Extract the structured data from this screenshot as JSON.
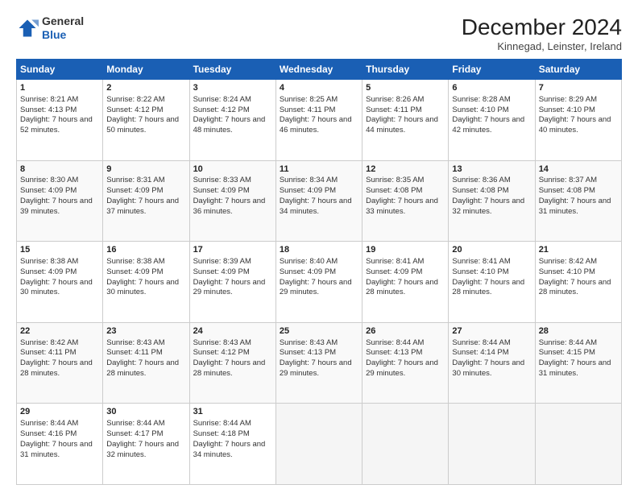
{
  "header": {
    "logo_line1": "General",
    "logo_line2": "Blue",
    "month_title": "December 2024",
    "location": "Kinnegad, Leinster, Ireland"
  },
  "days_of_week": [
    "Sunday",
    "Monday",
    "Tuesday",
    "Wednesday",
    "Thursday",
    "Friday",
    "Saturday"
  ],
  "weeks": [
    [
      {
        "day": 1,
        "sunrise": "8:21 AM",
        "sunset": "4:13 PM",
        "daylight": "7 hours and 52 minutes."
      },
      {
        "day": 2,
        "sunrise": "8:22 AM",
        "sunset": "4:12 PM",
        "daylight": "7 hours and 50 minutes."
      },
      {
        "day": 3,
        "sunrise": "8:24 AM",
        "sunset": "4:12 PM",
        "daylight": "7 hours and 48 minutes."
      },
      {
        "day": 4,
        "sunrise": "8:25 AM",
        "sunset": "4:11 PM",
        "daylight": "7 hours and 46 minutes."
      },
      {
        "day": 5,
        "sunrise": "8:26 AM",
        "sunset": "4:11 PM",
        "daylight": "7 hours and 44 minutes."
      },
      {
        "day": 6,
        "sunrise": "8:28 AM",
        "sunset": "4:10 PM",
        "daylight": "7 hours and 42 minutes."
      },
      {
        "day": 7,
        "sunrise": "8:29 AM",
        "sunset": "4:10 PM",
        "daylight": "7 hours and 40 minutes."
      }
    ],
    [
      {
        "day": 8,
        "sunrise": "8:30 AM",
        "sunset": "4:09 PM",
        "daylight": "7 hours and 39 minutes."
      },
      {
        "day": 9,
        "sunrise": "8:31 AM",
        "sunset": "4:09 PM",
        "daylight": "7 hours and 37 minutes."
      },
      {
        "day": 10,
        "sunrise": "8:33 AM",
        "sunset": "4:09 PM",
        "daylight": "7 hours and 36 minutes."
      },
      {
        "day": 11,
        "sunrise": "8:34 AM",
        "sunset": "4:09 PM",
        "daylight": "7 hours and 34 minutes."
      },
      {
        "day": 12,
        "sunrise": "8:35 AM",
        "sunset": "4:08 PM",
        "daylight": "7 hours and 33 minutes."
      },
      {
        "day": 13,
        "sunrise": "8:36 AM",
        "sunset": "4:08 PM",
        "daylight": "7 hours and 32 minutes."
      },
      {
        "day": 14,
        "sunrise": "8:37 AM",
        "sunset": "4:08 PM",
        "daylight": "7 hours and 31 minutes."
      }
    ],
    [
      {
        "day": 15,
        "sunrise": "8:38 AM",
        "sunset": "4:09 PM",
        "daylight": "7 hours and 30 minutes."
      },
      {
        "day": 16,
        "sunrise": "8:38 AM",
        "sunset": "4:09 PM",
        "daylight": "7 hours and 30 minutes."
      },
      {
        "day": 17,
        "sunrise": "8:39 AM",
        "sunset": "4:09 PM",
        "daylight": "7 hours and 29 minutes."
      },
      {
        "day": 18,
        "sunrise": "8:40 AM",
        "sunset": "4:09 PM",
        "daylight": "7 hours and 29 minutes."
      },
      {
        "day": 19,
        "sunrise": "8:41 AM",
        "sunset": "4:09 PM",
        "daylight": "7 hours and 28 minutes."
      },
      {
        "day": 20,
        "sunrise": "8:41 AM",
        "sunset": "4:10 PM",
        "daylight": "7 hours and 28 minutes."
      },
      {
        "day": 21,
        "sunrise": "8:42 AM",
        "sunset": "4:10 PM",
        "daylight": "7 hours and 28 minutes."
      }
    ],
    [
      {
        "day": 22,
        "sunrise": "8:42 AM",
        "sunset": "4:11 PM",
        "daylight": "7 hours and 28 minutes."
      },
      {
        "day": 23,
        "sunrise": "8:43 AM",
        "sunset": "4:11 PM",
        "daylight": "7 hours and 28 minutes."
      },
      {
        "day": 24,
        "sunrise": "8:43 AM",
        "sunset": "4:12 PM",
        "daylight": "7 hours and 28 minutes."
      },
      {
        "day": 25,
        "sunrise": "8:43 AM",
        "sunset": "4:13 PM",
        "daylight": "7 hours and 29 minutes."
      },
      {
        "day": 26,
        "sunrise": "8:44 AM",
        "sunset": "4:13 PM",
        "daylight": "7 hours and 29 minutes."
      },
      {
        "day": 27,
        "sunrise": "8:44 AM",
        "sunset": "4:14 PM",
        "daylight": "7 hours and 30 minutes."
      },
      {
        "day": 28,
        "sunrise": "8:44 AM",
        "sunset": "4:15 PM",
        "daylight": "7 hours and 31 minutes."
      }
    ],
    [
      {
        "day": 29,
        "sunrise": "8:44 AM",
        "sunset": "4:16 PM",
        "daylight": "7 hours and 31 minutes."
      },
      {
        "day": 30,
        "sunrise": "8:44 AM",
        "sunset": "4:17 PM",
        "daylight": "7 hours and 32 minutes."
      },
      {
        "day": 31,
        "sunrise": "8:44 AM",
        "sunset": "4:18 PM",
        "daylight": "7 hours and 34 minutes."
      },
      null,
      null,
      null,
      null
    ]
  ]
}
